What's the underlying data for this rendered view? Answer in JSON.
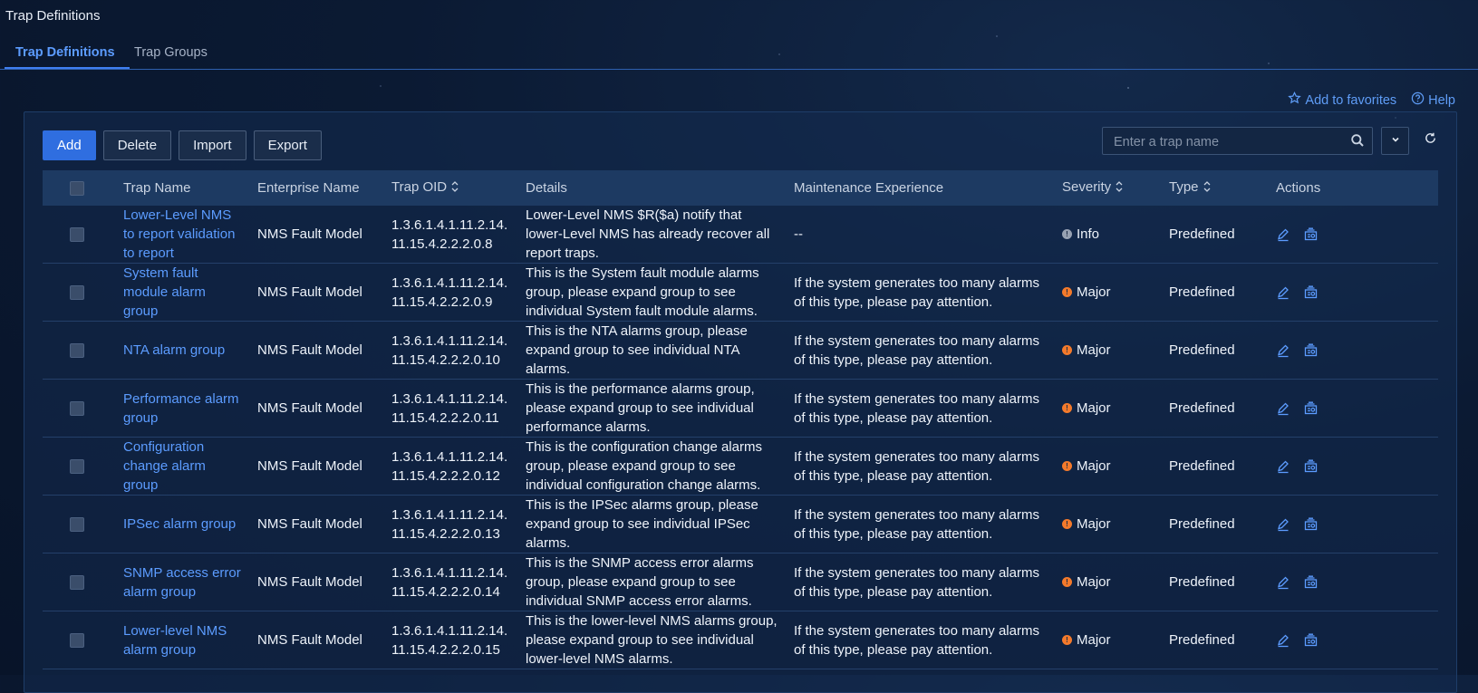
{
  "page": {
    "title": "Trap Definitions"
  },
  "tabs": [
    {
      "label": "Trap Definitions",
      "active": true
    },
    {
      "label": "Trap Groups",
      "active": false
    }
  ],
  "links": {
    "favorites": "Add to favorites",
    "help": "Help"
  },
  "toolbar": {
    "add": "Add",
    "delete": "Delete",
    "import": "Import",
    "export": "Export"
  },
  "search": {
    "placeholder": "Enter a trap name",
    "value": ""
  },
  "table": {
    "columns": {
      "name": "Trap Name",
      "enterprise": "Enterprise Name",
      "oid": "Trap OID",
      "details": "Details",
      "maintenance": "Maintenance Experience",
      "severity": "Severity",
      "type": "Type",
      "actions": "Actions"
    },
    "rows": [
      {
        "name": "Lower-Level NMS to report validation to report",
        "enterprise": "NMS Fault Model",
        "oid": "1.3.6.1.4.1.11.2.14.11.15.4.2.2.2.0.8",
        "details": "Lower-Level NMS $R($a) notify that lower-Level NMS has already recover all report traps.",
        "maintenance": "--",
        "severity": "Info",
        "type": "Predefined"
      },
      {
        "name": "System fault module alarm group",
        "enterprise": "NMS Fault Model",
        "oid": "1.3.6.1.4.1.11.2.14.11.15.4.2.2.2.0.9",
        "details": "This is the System fault module alarms group, please expand group to see individual System fault module alarms.",
        "maintenance": "If the system generates too many alarms of this type, please pay attention.",
        "severity": "Major",
        "type": "Predefined"
      },
      {
        "name": "NTA alarm group",
        "enterprise": "NMS Fault Model",
        "oid": "1.3.6.1.4.1.11.2.14.11.15.4.2.2.2.0.10",
        "details": "This is the NTA alarms group, please expand group to see individual NTA alarms.",
        "maintenance": "If the system generates too many alarms of this type, please pay attention.",
        "severity": "Major",
        "type": "Predefined"
      },
      {
        "name": "Performance alarm group",
        "enterprise": "NMS Fault Model",
        "oid": "1.3.6.1.4.1.11.2.14.11.15.4.2.2.2.0.11",
        "details": "This is the performance alarms group, please expand group to see individual performance alarms.",
        "maintenance": "If the system generates too many alarms of this type, please pay attention.",
        "severity": "Major",
        "type": "Predefined"
      },
      {
        "name": "Configuration change alarm group",
        "enterprise": "NMS Fault Model",
        "oid": "1.3.6.1.4.1.11.2.14.11.15.4.2.2.2.0.12",
        "details": "This is the configuration change alarms group, please expand group to see individual configuration change alarms.",
        "maintenance": "If the system generates too many alarms of this type, please pay attention.",
        "severity": "Major",
        "type": "Predefined"
      },
      {
        "name": "IPSec alarm group",
        "enterprise": "NMS Fault Model",
        "oid": "1.3.6.1.4.1.11.2.14.11.15.4.2.2.2.0.13",
        "details": "This is the IPSec alarms group, please expand group to see individual IPSec alarms.",
        "maintenance": "If the system generates too many alarms of this type, please pay attention.",
        "severity": "Major",
        "type": "Predefined"
      },
      {
        "name": "SNMP access error alarm group",
        "enterprise": "NMS Fault Model",
        "oid": "1.3.6.1.4.1.11.2.14.11.15.4.2.2.2.0.14",
        "details": "This is the SNMP access error alarms group, please expand group to see individual SNMP access error alarms.",
        "maintenance": "If the system generates too many alarms of this type, please pay attention.",
        "severity": "Major",
        "type": "Predefined"
      },
      {
        "name": "Lower-level NMS alarm group",
        "enterprise": "NMS Fault Model",
        "oid": "1.3.6.1.4.1.11.2.14.11.15.4.2.2.2.0.15",
        "details": "This is the lower-level NMS alarms group, please expand group to see individual lower-level NMS alarms.",
        "maintenance": "If the system generates too many alarms of this type, please pay attention.",
        "severity": "Major",
        "type": "Predefined"
      }
    ]
  },
  "colors": {
    "accent": "#3f7ef0",
    "link": "#5c9cff",
    "major": "#f47a2b",
    "info": "#98a2b3"
  },
  "icons": {
    "favorites": "star-plus-icon",
    "help": "help-circle-icon",
    "search": "search-icon",
    "dropdown": "chevron-down-icon",
    "refresh": "refresh-icon",
    "edit": "edit-icon",
    "copy": "copy-icon"
  }
}
